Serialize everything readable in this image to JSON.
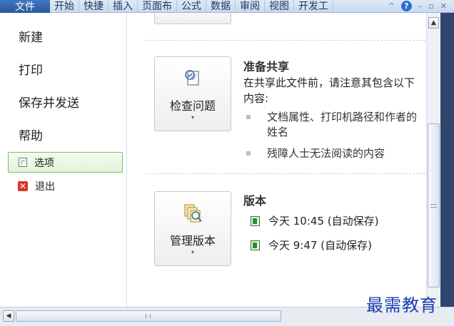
{
  "ribbon": {
    "file_tab": "文件",
    "tabs": [
      "开始",
      "快捷",
      "插入",
      "页面布",
      "公式",
      "数据",
      "审阅",
      "视图",
      "开发工"
    ],
    "controls": {
      "collapse": "^",
      "help": "?",
      "minimize": "–",
      "restore": "▫",
      "close": "✕"
    }
  },
  "nav": {
    "new": "新建",
    "print": "打印",
    "save_send": "保存并发送",
    "help": "帮助",
    "options": "选项",
    "exit": "退出"
  },
  "prepare_share": {
    "button_label": "检查问题",
    "caret": "▾",
    "title": "准备共享",
    "description": "在共享此文件前，请注意其包含以下内容:",
    "bullets": [
      "文档属性、打印机路径和作者的姓名",
      "残障人士无法阅读的内容"
    ]
  },
  "versions": {
    "button_label": "管理版本",
    "caret": "▾",
    "title": "版本",
    "items": [
      "今天 10:45 (自动保存)",
      "今天 9:47 (自动保存)"
    ]
  },
  "scrollbars": {
    "up": "▲",
    "left": "◀"
  },
  "watermark": "最需教育",
  "colors": {
    "accent": "#2b5797",
    "selected_border": "#7cbe68",
    "excel_green": "#2f8a33"
  },
  "icons": {
    "inspect": "inspect-document-icon",
    "versions": "manage-versions-icon",
    "file": "excel-file-icon"
  }
}
